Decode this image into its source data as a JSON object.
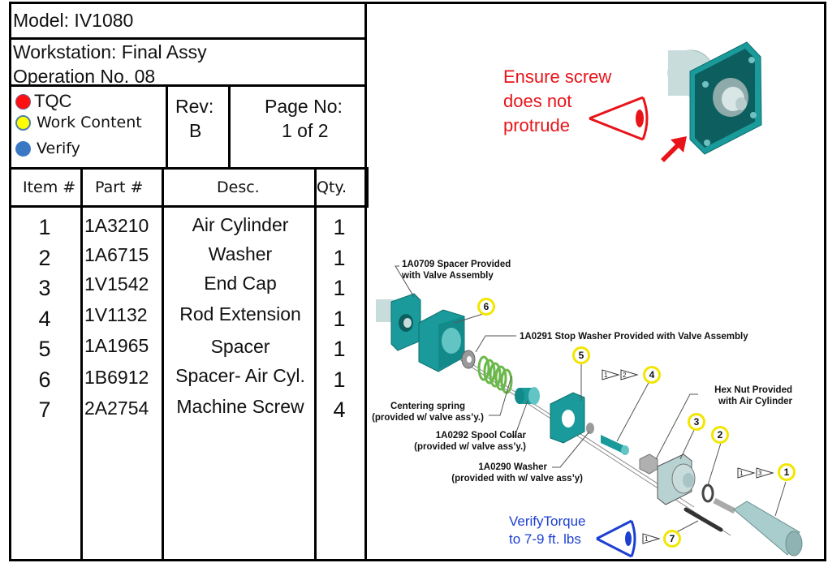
{
  "header": {
    "model_label": "Model: IV1080",
    "workstation_label": "Workstation: Final Assy",
    "operation_label": "Operation No.  08",
    "rev_label": "Rev:",
    "rev_value": "B",
    "page_label": "Page No:",
    "page_value": "1 of 2"
  },
  "legend": [
    {
      "label": "TQC",
      "color": "#ff1010",
      "icon": "red-circle"
    },
    {
      "label": "Work Content",
      "color": "#ffff00",
      "icon": "yellow-circle"
    },
    {
      "label": "Verify",
      "color": "#3b78c4",
      "icon": "blue-circle"
    }
  ],
  "parts_table": {
    "columns": [
      "Item #",
      "Part #",
      "Desc.",
      "Qty."
    ],
    "rows": [
      {
        "item": "1",
        "part": "1A3210",
        "desc": "Air Cylinder",
        "qty": "1"
      },
      {
        "item": "2",
        "part": "1A6715",
        "desc": "Washer",
        "qty": "1"
      },
      {
        "item": "3",
        "part": "1V1542",
        "desc": "End Cap",
        "qty": "1"
      },
      {
        "item": "4",
        "part": "1V1132",
        "desc": "Rod Extension",
        "qty": "1"
      },
      {
        "item": "5",
        "part": "1A1965",
        "desc": "Spacer",
        "qty": "1"
      },
      {
        "item": "6",
        "part": "1B6912",
        "desc": "Spacer- Air Cyl.",
        "qty": "1"
      },
      {
        "item": "7",
        "part": "2A2754",
        "desc": "Machine Screw",
        "qty": "4"
      }
    ]
  },
  "notes": {
    "tqc_note": [
      "Ensure screw",
      "does not",
      "protrude"
    ],
    "verify_note": [
      "VerifyTorque",
      "to 7-9 ft. lbs"
    ],
    "tqc_color": "#e8141a",
    "verify_color": "#1c3fd1"
  },
  "diagram": {
    "callouts": {
      "spacer_valve": [
        "1A0709 Spacer Provided",
        "with Valve Assembly"
      ],
      "stop_washer": "1A0291 Stop Washer Provided with Valve Assembly",
      "hex_nut": [
        "Hex Nut Provided",
        "with Air Cylinder"
      ],
      "centering_spring": [
        "Centering spring",
        "(provided w/ valve ass’y.)"
      ],
      "spool_collar": [
        "1A0292 Spool Collar",
        "(provided w/ valve ass’y.)"
      ],
      "washer_0290": [
        "1A0290 Washer",
        "(provided with w/ valve ass’y)"
      ]
    },
    "balloons": [
      "1",
      "2",
      "3",
      "4",
      "5",
      "6",
      "7"
    ],
    "sequence_flags": {
      "item4": [
        "1",
        "2"
      ],
      "item1": [
        "1",
        "3"
      ],
      "item7": [
        "1"
      ]
    },
    "part_color": "#1a9a9a",
    "balloon_color": "#f2e600"
  }
}
